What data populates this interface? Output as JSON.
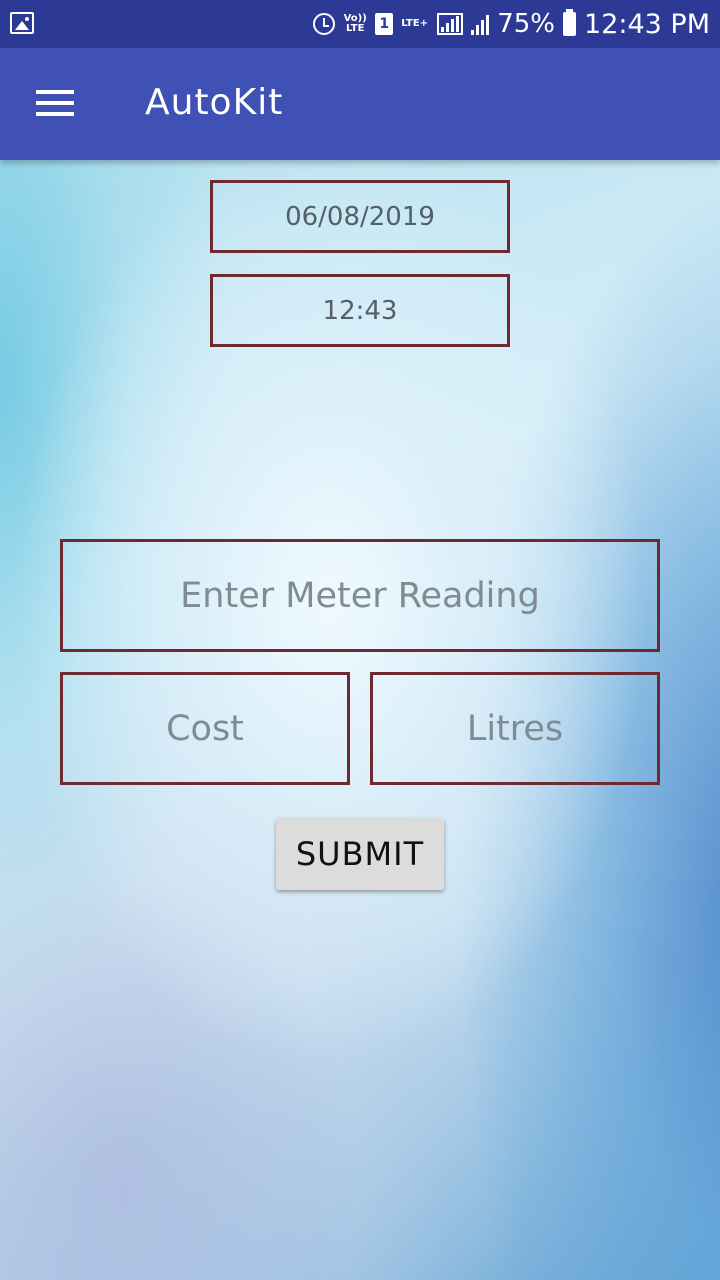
{
  "status_bar": {
    "icons": [
      "gallery-icon",
      "alarm-icon",
      "volte-icon",
      "sim-1-icon",
      "lte-icon",
      "signal-icon",
      "signal-icon",
      "battery-icon"
    ],
    "volte_label": "Vo)) LTE",
    "sim_label": "1",
    "lte_label": "LTE+",
    "battery_percent": "75%",
    "time": "12:43 PM"
  },
  "app_bar": {
    "title": "AutoKit",
    "menu_icon": "hamburger-menu-icon",
    "color": "#3f51b5"
  },
  "form": {
    "date_value": "06/08/2019",
    "time_value": "12:43",
    "meter_placeholder": "Enter Meter Reading",
    "cost_placeholder": "Cost",
    "litres_placeholder": "Litres",
    "submit_label": "SUBMIT",
    "border_color": "#6e2a2e"
  }
}
